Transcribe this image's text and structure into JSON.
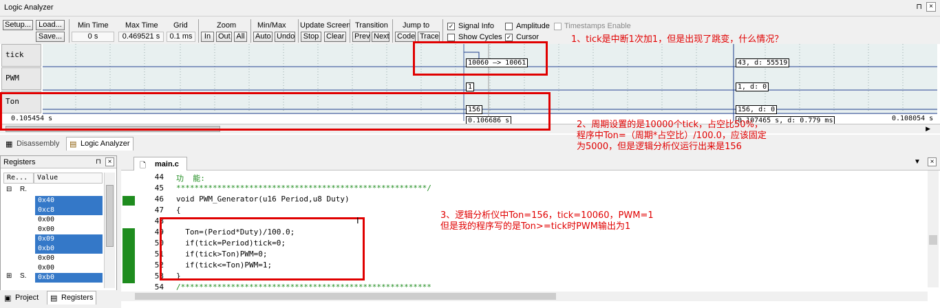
{
  "logic_analyzer": {
    "title": "Logic Analyzer",
    "pin": "⊓",
    "close": "×",
    "setup": "Setup...",
    "load": "Load...",
    "save": "Save...",
    "min_time_label": "Min Time",
    "min_time_value": "0 s",
    "max_time_label": "Max Time",
    "max_time_value": "0.469521 s",
    "grid_label": "Grid",
    "grid_value": "0.1 ms",
    "zoom_label": "Zoom",
    "zoom_in": "In",
    "zoom_out": "Out",
    "zoom_all": "All",
    "minmax_label": "Min/Max",
    "auto": "Auto",
    "undo": "Undo",
    "update_label": "Update Screen",
    "stop": "Stop",
    "clear": "Clear",
    "transition_label": "Transition",
    "prev": "Prev",
    "next": "Next",
    "jump_label": "Jump to",
    "code": "Code",
    "trace": "Trace",
    "signal_info": "Signal Info",
    "amplitude": "Amplitude",
    "timestamps": "Timestamps Enable",
    "show_cycles": "Show Cycles",
    "cursor": "Cursor",
    "signals": [
      "tick",
      "PWM",
      "Ton"
    ],
    "wave_labels": {
      "tick_transition": "10060 —> 10061",
      "tick_cursor": "43,  d: 55519",
      "pwm_value": "1",
      "pwm_cursor": "1,  d: 0",
      "ton_value": "156",
      "ton_cursor": "156,  d: 0",
      "time_left": "0.105454 s",
      "time_mid": "0.106686 s",
      "time_cursor": "0.107465 s,  d: 0.779 ms",
      "time_right": "0.108054 s"
    }
  },
  "tabs": {
    "disassembly": "Disassembly",
    "logic_analyzer": "Logic Analyzer"
  },
  "registers": {
    "title": "Registers",
    "col_register": "Re...",
    "col_value": "Value",
    "group_r": "R.",
    "group_s": "S.",
    "values": [
      "0x40",
      "0xc8",
      "0x00",
      "0x00",
      "0x09",
      "0xb0",
      "0x00",
      "0x00",
      "0xb0"
    ],
    "selected": [
      true,
      true,
      false,
      false,
      true,
      true,
      false,
      false,
      true
    ],
    "tab_project": "Project",
    "tab_registers": "Registers"
  },
  "editor": {
    "file_tab": "main.c",
    "lines": [
      {
        "no": "44",
        "text": "功  能:"
      },
      {
        "no": "45",
        "text": "*******************************************************/"
      },
      {
        "no": "46",
        "text": "void PWM_Generator(u16 Period,u8 Duty)"
      },
      {
        "no": "47",
        "text": "{"
      },
      {
        "no": "48",
        "text": ""
      },
      {
        "no": "49",
        "text": "  Ton=(Period*Duty)/100.0;"
      },
      {
        "no": "50",
        "text": "  if(tick=Period)tick=0;"
      },
      {
        "no": "51",
        "text": "  if(tick>Ton)PWM=0;"
      },
      {
        "no": "52",
        "text": "  if(tick<=Ton)PWM=1;"
      },
      {
        "no": "53",
        "text": "}"
      },
      {
        "no": "54",
        "text": "/*******************************************************"
      }
    ]
  },
  "annotations": {
    "a1": "1、tick是中断1次加1，但是出现了跳变，什么情况？",
    "a2_1": "2、周期设置的是10000个tick，占空比50%，",
    "a2_2": "程序中Ton=（周期*占空比）/100.0，应该固定",
    "a2_3": "为5000，但是逻辑分析仪运行出来是156",
    "a3_1": "3、逻辑分析仪中Ton=156，tick=10060，PWM=1",
    "a3_2": "但是我的程序写的是Ton>=tick时PWM输出为1"
  },
  "colors": {
    "annotation": "#e00000",
    "selection": "#3478c8",
    "coverage": "#1e8c1e"
  }
}
